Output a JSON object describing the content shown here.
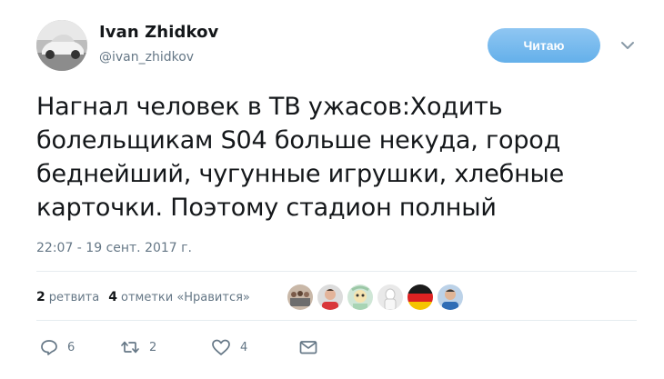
{
  "author": {
    "name": "Ivan Zhidkov",
    "handle": "@ivan_zhidkov"
  },
  "follow_button": {
    "label": "Читаю",
    "color": "#74b9ee"
  },
  "tweet": {
    "lines": [
      "Нагнал человек в ТВ ужасов:Ходить",
      "болельщикам S04 больше некуда, город",
      "беднейший, чугунные игрушки, хлебные",
      "карточки. Поэтому стадион полный"
    ],
    "timestamp": "22:07 - 19 сент. 2017 г."
  },
  "stats": {
    "retweets_count": "2",
    "retweets_label": "ретвита",
    "likes_count": "4",
    "likes_label": "отметки «Нравится»"
  },
  "likers": [
    {
      "icon": "group-photo-avatar"
    },
    {
      "icon": "man-red-shirt-avatar"
    },
    {
      "icon": "cartoon-avatar"
    },
    {
      "icon": "white-figure-avatar"
    },
    {
      "icon": "german-flag-avatar"
    },
    {
      "icon": "man-blue-shirt-avatar"
    }
  ],
  "actions": {
    "reply_count": "6",
    "retweet_count": "2",
    "like_count": "4"
  },
  "colors": {
    "text_primary": "#14171a",
    "text_secondary": "#657786",
    "divider": "#e6ecf0",
    "accent_blue": "#1da1f2"
  }
}
